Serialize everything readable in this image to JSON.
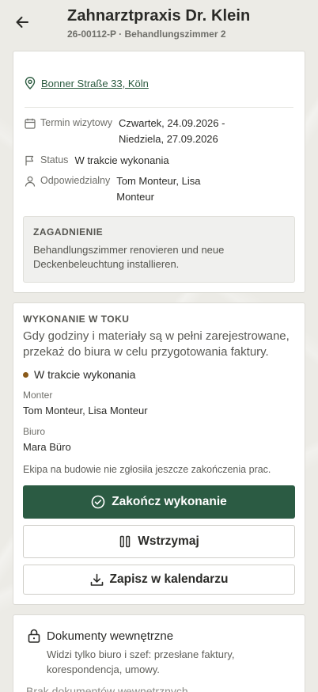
{
  "header": {
    "title": "Zahnarztpraxis Dr. Klein",
    "subtitle": "26-00112-P · Behandlungszimmer 2",
    "back_icon": "arrow-left-icon"
  },
  "details": {
    "address": "Bonner Straße 33, Köln",
    "date_label": "Termin wizytowy",
    "date_value_line1": "Czwartek, 24.09.2026 -",
    "date_value_line2": "Niedziela, 27.09.2026",
    "status_label": "Status",
    "status_value": "W trakcie wykonania",
    "responsible_label": "Odpowiedzialny",
    "responsible_line1": "Tom Monteur, Lisa",
    "responsible_line2": "Monteur",
    "issue_title": "ZAGADNIENIE",
    "issue_line1": "Behandlungszimmer renovieren und neue",
    "issue_line2": "Deckenbeleuchtung installieren."
  },
  "execution": {
    "section_title": "WYKONANIE W TOKU",
    "desc_line1": "Gdy godziny i materiały są w pełni zarejestrowane,",
    "desc_line2": "przekaż do biura w celu przygotowania faktury.",
    "status": "W trakcie wykonania",
    "status_color": "#8a5a1a",
    "installer_label": "Monter",
    "installer_value": "Tom Monteur, Lisa Monteur",
    "office_label": "Biuro",
    "office_value": "Mara Büro",
    "note": "Ekipa na budowie nie zgłosiła jeszcze zakończenia prac.",
    "complete_button": "Zakończ wykonanie",
    "pause_button": "Wstrzymaj",
    "calendar_button": "Zapisz w kalendarzu"
  },
  "documents": {
    "title": "Dokumenty wewnętrzne",
    "desc_line1": "Widzi tylko biuro i szef: przesłane faktury,",
    "desc_line2": "korespondencja, umowy.",
    "empty": "Brak dokumentów wewnętrznych"
  },
  "colors": {
    "accent": "#2b5b43",
    "link": "#2a5a3e",
    "background": "#ecebe6"
  }
}
